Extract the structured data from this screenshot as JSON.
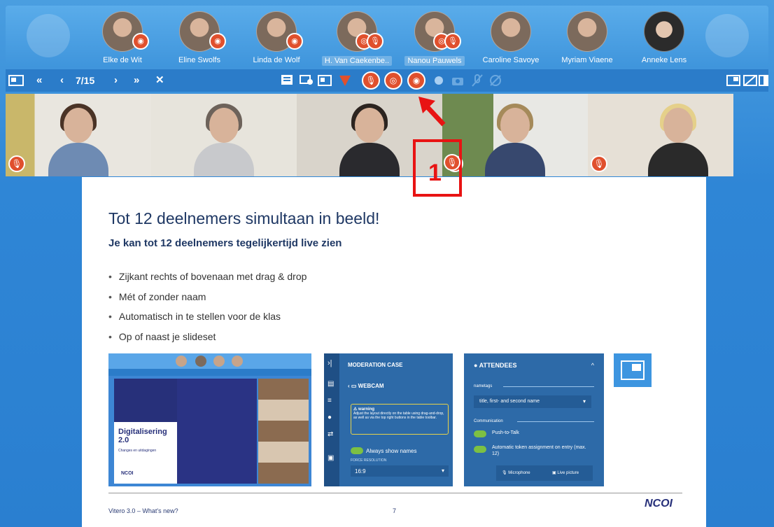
{
  "participants": [
    {
      "name": "Elke de Wit",
      "badges": 1,
      "selected": false
    },
    {
      "name": "Eline Swolfs",
      "badges": 1,
      "selected": false
    },
    {
      "name": "Linda de Wolf",
      "badges": 1,
      "selected": false
    },
    {
      "name": "H. Van Caekenbe..",
      "badges": 2,
      "selected": true
    },
    {
      "name": "Nanou Pauwels",
      "badges": 2,
      "selected": true
    },
    {
      "name": "Caroline Savoye",
      "badges": 0,
      "selected": false
    },
    {
      "name": "Myriam Viaene",
      "badges": 0,
      "selected": false
    },
    {
      "name": "Anneke Lens",
      "badges": 0,
      "selected": false
    }
  ],
  "toolbar": {
    "page_indicator": "7/15"
  },
  "slide": {
    "title": "Tot 12 deelnemers simultaan in beeld!",
    "subtitle": "Je kan tot 12 deelnemers tegelijkertijd live zien",
    "bullets": [
      "Zijkant rechts of bovenaan met drag & drop",
      "Mét of zonder naam",
      "Automatisch in te stellen voor de klas",
      "Op of naast je slideset"
    ],
    "footer_left": "Vitero 3.0 – What's new?",
    "page_number": "7",
    "logo_text": "NCOI"
  },
  "screenshot1": {
    "title": "Digitalisering 2.0",
    "subtitle": "Changes en uitdagingen",
    "logo": "NCOI"
  },
  "screenshot2": {
    "header": "MODERATION CASE",
    "section": "WEBCAM",
    "warning_title": "warning",
    "warning_text": "Adjust the layout directly on the table using drag-and-drop, as well as via the top right buttons in the table toolbar.",
    "toggle_label": "Always show names",
    "force_label": "FORCE RESOLUTION",
    "resolution": "16:9"
  },
  "screenshot3": {
    "header": "ATTENDEES",
    "nametags_label": "nametags",
    "nametags_value": "title, first- and second name",
    "communication_label": "Communication",
    "toggle1": "Push-to-Talk",
    "toggle2": "Automatic token assignment on entry (max. 12)",
    "btn_microphone": "Microphone",
    "btn_live": "Live picture"
  },
  "annotation": {
    "number": "1"
  },
  "colors": {
    "accent": "#2b7cc9",
    "badge": "#e0502d",
    "annotation": "#e81313",
    "slide_text": "#1f3864",
    "panel": "#2d6aa8"
  }
}
